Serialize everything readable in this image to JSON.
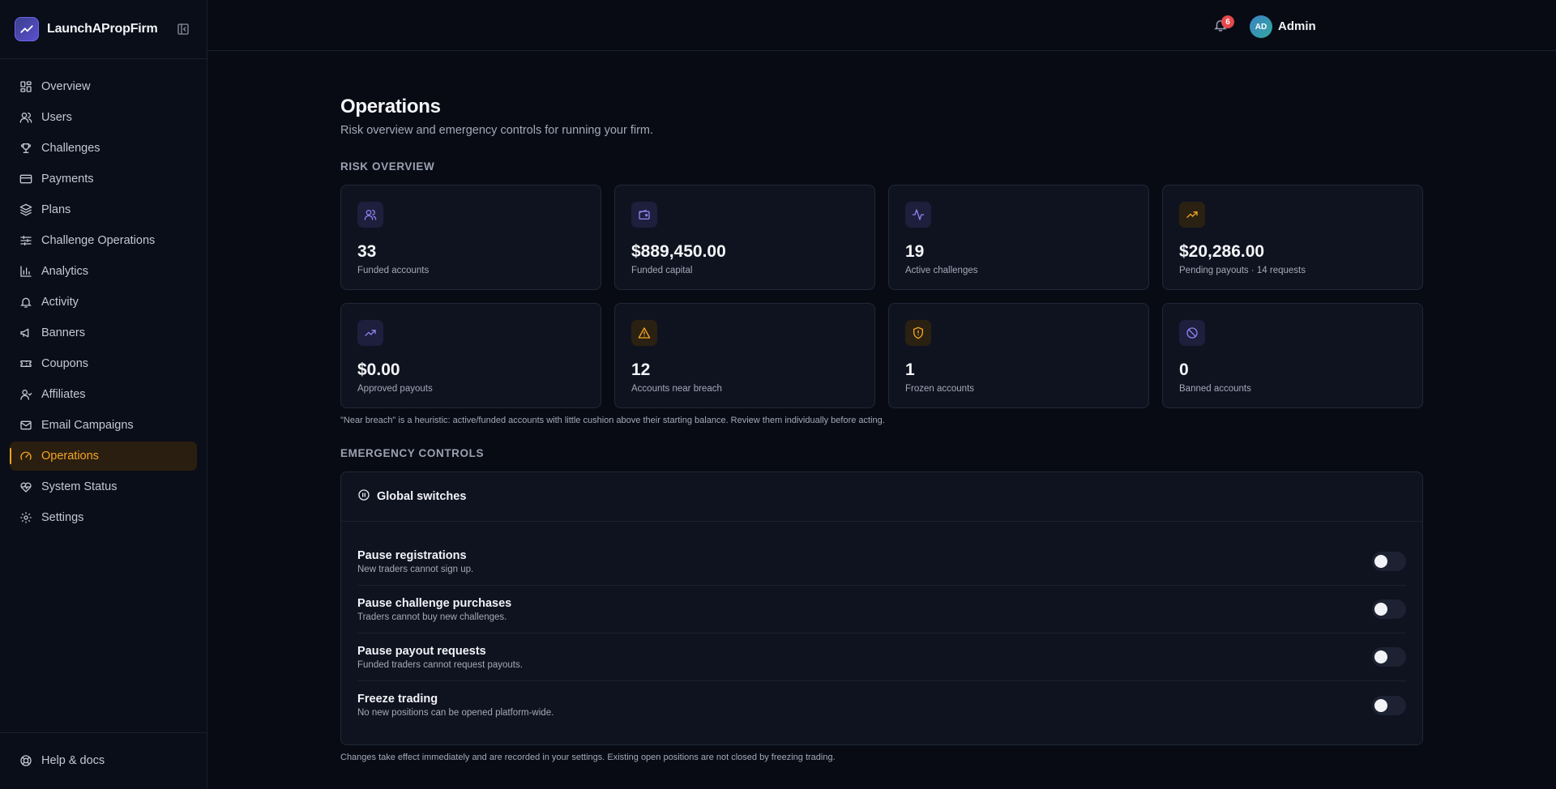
{
  "brand": {
    "name": "LaunchAPropFirm"
  },
  "sidebar": {
    "items": [
      {
        "label": "Overview",
        "icon": "grid-icon"
      },
      {
        "label": "Users",
        "icon": "users-icon"
      },
      {
        "label": "Challenges",
        "icon": "trophy-icon"
      },
      {
        "label": "Payments",
        "icon": "credit-card-icon"
      },
      {
        "label": "Plans",
        "icon": "layers-icon"
      },
      {
        "label": "Challenge Operations",
        "icon": "sliders-icon"
      },
      {
        "label": "Analytics",
        "icon": "bar-chart-icon"
      },
      {
        "label": "Activity",
        "icon": "bell-icon"
      },
      {
        "label": "Banners",
        "icon": "megaphone-icon"
      },
      {
        "label": "Coupons",
        "icon": "ticket-icon"
      },
      {
        "label": "Affiliates",
        "icon": "user-icon"
      },
      {
        "label": "Email Campaigns",
        "icon": "mail-icon"
      },
      {
        "label": "Operations",
        "icon": "gauge-icon",
        "active": true
      },
      {
        "label": "System Status",
        "icon": "heart-pulse-icon"
      },
      {
        "label": "Settings",
        "icon": "gear-icon"
      }
    ],
    "help": {
      "label": "Help & docs",
      "icon": "lifebuoy-icon"
    }
  },
  "topbar": {
    "notification_count": "6",
    "avatar_initials": "AD",
    "user_name": "Admin"
  },
  "page": {
    "title": "Operations",
    "subtitle": "Risk overview and emergency controls for running your firm."
  },
  "risk_overview": {
    "heading": "RISK OVERVIEW",
    "cards": [
      {
        "value": "33",
        "label": "Funded accounts",
        "icon": "users-icon",
        "tone": "violet"
      },
      {
        "value": "$889,450.00",
        "label": "Funded capital",
        "icon": "wallet-icon",
        "tone": "violet"
      },
      {
        "value": "19",
        "label": "Active challenges",
        "icon": "activity-icon",
        "tone": "violet"
      },
      {
        "value": "$20,286.00",
        "label": "Pending payouts · 14 requests",
        "icon": "trending-up-icon",
        "tone": "amber"
      },
      {
        "value": "$0.00",
        "label": "Approved payouts",
        "icon": "trending-up-icon",
        "tone": "violet"
      },
      {
        "value": "12",
        "label": "Accounts near breach",
        "icon": "alert-triangle-icon",
        "tone": "amber"
      },
      {
        "value": "1",
        "label": "Frozen accounts",
        "icon": "shield-alert-icon",
        "tone": "amber"
      },
      {
        "value": "0",
        "label": "Banned accounts",
        "icon": "ban-icon",
        "tone": "violet"
      }
    ],
    "note": "\"Near breach\" is a heuristic: active/funded accounts with little cushion above their starting balance. Review them individually before acting."
  },
  "emergency": {
    "heading": "EMERGENCY CONTROLS",
    "panel_title": "Global switches",
    "switches": [
      {
        "title": "Pause registrations",
        "desc": "New traders cannot sign up.",
        "on": false
      },
      {
        "title": "Pause challenge purchases",
        "desc": "Traders cannot buy new challenges.",
        "on": false
      },
      {
        "title": "Pause payout requests",
        "desc": "Funded traders cannot request payouts.",
        "on": false
      },
      {
        "title": "Freeze trading",
        "desc": "No new positions can be opened platform-wide.",
        "on": false
      }
    ],
    "footnote": "Changes take effect immediately and are recorded in your settings. Existing open positions are not closed by freezing trading."
  },
  "colors": {
    "accent": "#f5a524",
    "violet": "#8b84f0",
    "amber": "#f5a524",
    "badge": "#e5484d"
  }
}
